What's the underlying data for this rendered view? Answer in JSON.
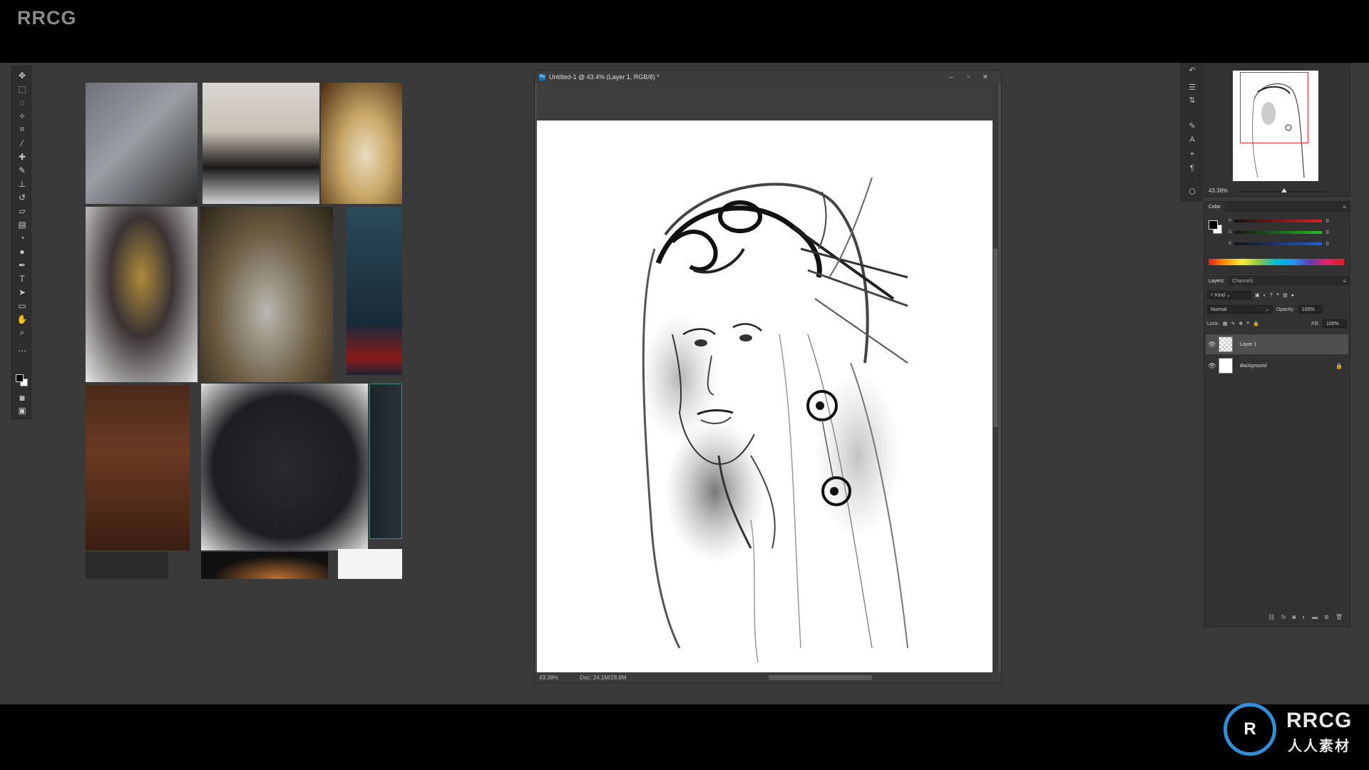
{
  "watermark": {
    "top_left": "RRCG"
  },
  "document": {
    "title": "Untitled-1 @ 43.4% (Layer 1, RGB/8) *",
    "status_zoom": "43.38%",
    "status_doc": "Doc: 24.1M/28.8M"
  },
  "navigator": {
    "zoom": "43.38%"
  },
  "color_panel": {
    "tab": "Color",
    "channels": [
      {
        "label": "R",
        "value": "0",
        "color": "#e02020"
      },
      {
        "label": "G",
        "value": "0",
        "color": "#20c020"
      },
      {
        "label": "B",
        "value": "0",
        "color": "#2060e0"
      }
    ]
  },
  "layers_panel": {
    "tabs": [
      "Layers",
      "Channels"
    ],
    "filter": "Kind",
    "blend_mode": "Normal",
    "opacity_label": "Opacity:",
    "opacity_value": "100%",
    "lock_label": "Lock:",
    "fill_label": "Fill:",
    "fill_value": "100%",
    "layers": [
      {
        "name": "Layer 1",
        "selected": true
      },
      {
        "name": "Background",
        "selected": false
      }
    ]
  },
  "logo": {
    "name": "RRCG",
    "sub": "人人素材"
  }
}
